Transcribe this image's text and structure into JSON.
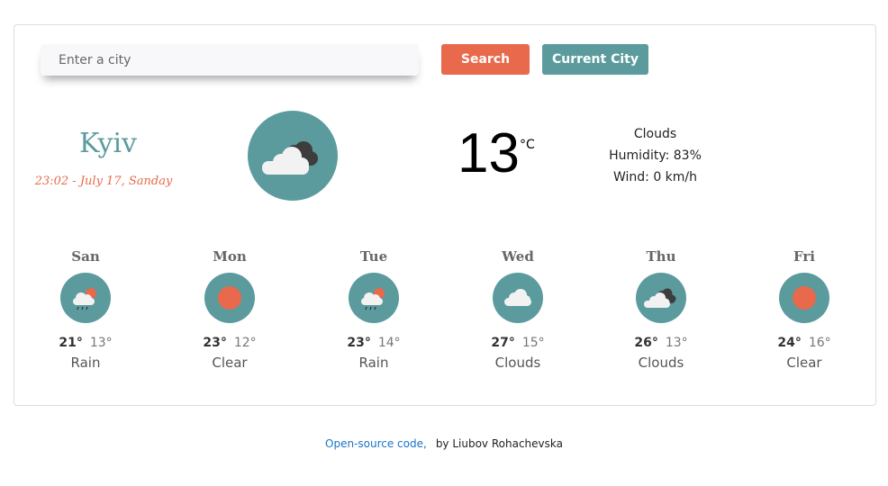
{
  "search": {
    "placeholder": "Enter a city",
    "search_label": "Search",
    "current_city_label": "Current City"
  },
  "current": {
    "city": "Kyiv",
    "datetime": "23:02 - July 17, Sanday",
    "temperature": "13",
    "unit": "°C",
    "description": "Clouds",
    "humidity": "Humidity: 83%",
    "wind": "Wind: 0 km/h",
    "icon": "broken-clouds-icon"
  },
  "forecast": [
    {
      "day": "San",
      "max": "21°",
      "min": "13°",
      "condition": "Rain",
      "icon": "rain-icon"
    },
    {
      "day": "Mon",
      "max": "23°",
      "min": "12°",
      "condition": "Clear",
      "icon": "sun-icon"
    },
    {
      "day": "Tue",
      "max": "23°",
      "min": "14°",
      "condition": "Rain",
      "icon": "rain-icon"
    },
    {
      "day": "Wed",
      "max": "27°",
      "min": "15°",
      "condition": "Clouds",
      "icon": "cloud-icon"
    },
    {
      "day": "Thu",
      "max": "26°",
      "min": "13°",
      "condition": "Clouds",
      "icon": "broken-clouds-icon"
    },
    {
      "day": "Fri",
      "max": "24°",
      "min": "16°",
      "condition": "Clear",
      "icon": "sun-icon"
    }
  ],
  "footer": {
    "link": "Open-source code,",
    "author": "by Liubov Rohachevska"
  },
  "colors": {
    "accent_orange": "#e8694b",
    "accent_teal": "#5b9b9e"
  }
}
